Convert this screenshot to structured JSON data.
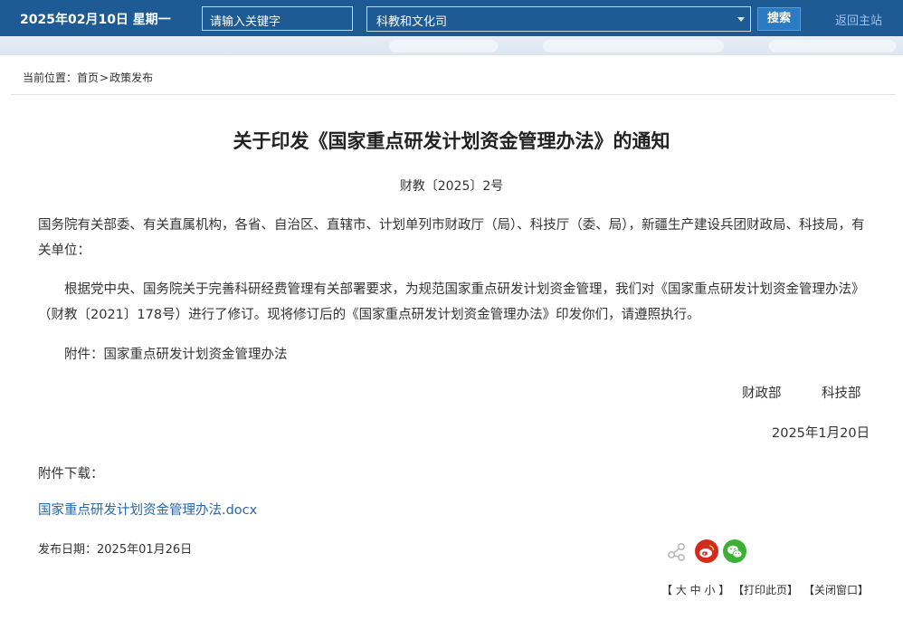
{
  "header": {
    "date": "2025年02月10日  星期一",
    "keyword_placeholder": "请输入关键字",
    "department_selected": "科教和文化司",
    "search_label": "搜索",
    "home_label": "返回主站"
  },
  "breadcrumb": {
    "prefix": "当前位置：",
    "home": "首页",
    "separator": ">",
    "current": "政策发布"
  },
  "article": {
    "title": "关于印发《国家重点研发计划资金管理办法》的通知",
    "doc_number": "财教〔2025〕2号",
    "recipients": "国务院有关部委、有关直属机构，各省、自治区、直辖市、计划单列市财政厅（局）、科技厅（委、局），新疆生产建设兵团财政局、科技局，有关单位：",
    "body": "根据党中央、国务院关于完善科研经费管理有关部署要求，为规范国家重点研发计划资金管理，我们对《国家重点研发计划资金管理办法》（财教〔2021〕178号）进行了修订。现将修订后的《国家重点研发计划资金管理办法》印发你们，请遵照执行。",
    "attachment_note": "附件：国家重点研发计划资金管理办法",
    "signer_1": "财政部",
    "signer_2": "科技部",
    "sign_date": "2025年1月20日"
  },
  "downloads": {
    "label": "附件下载：",
    "file_name": "国家重点研发计划资金管理办法.docx"
  },
  "publish": {
    "label_and_date": "发布日期：2025年01月26日"
  },
  "share": {
    "icons": [
      "share-link-icon",
      "weibo-icon",
      "wechat-icon"
    ],
    "colors": {
      "weibo": "#d52b1e",
      "wechat": "#3cb035",
      "link": "#b5b5b5"
    }
  },
  "tools": {
    "font_size": "【 大 中 小 】",
    "print": "【打印此页】",
    "close": "【关闭窗口】"
  },
  "colors": {
    "header_bg": "#1e5a94",
    "search_button": "#2a7bc4",
    "link": "#2866a8"
  }
}
